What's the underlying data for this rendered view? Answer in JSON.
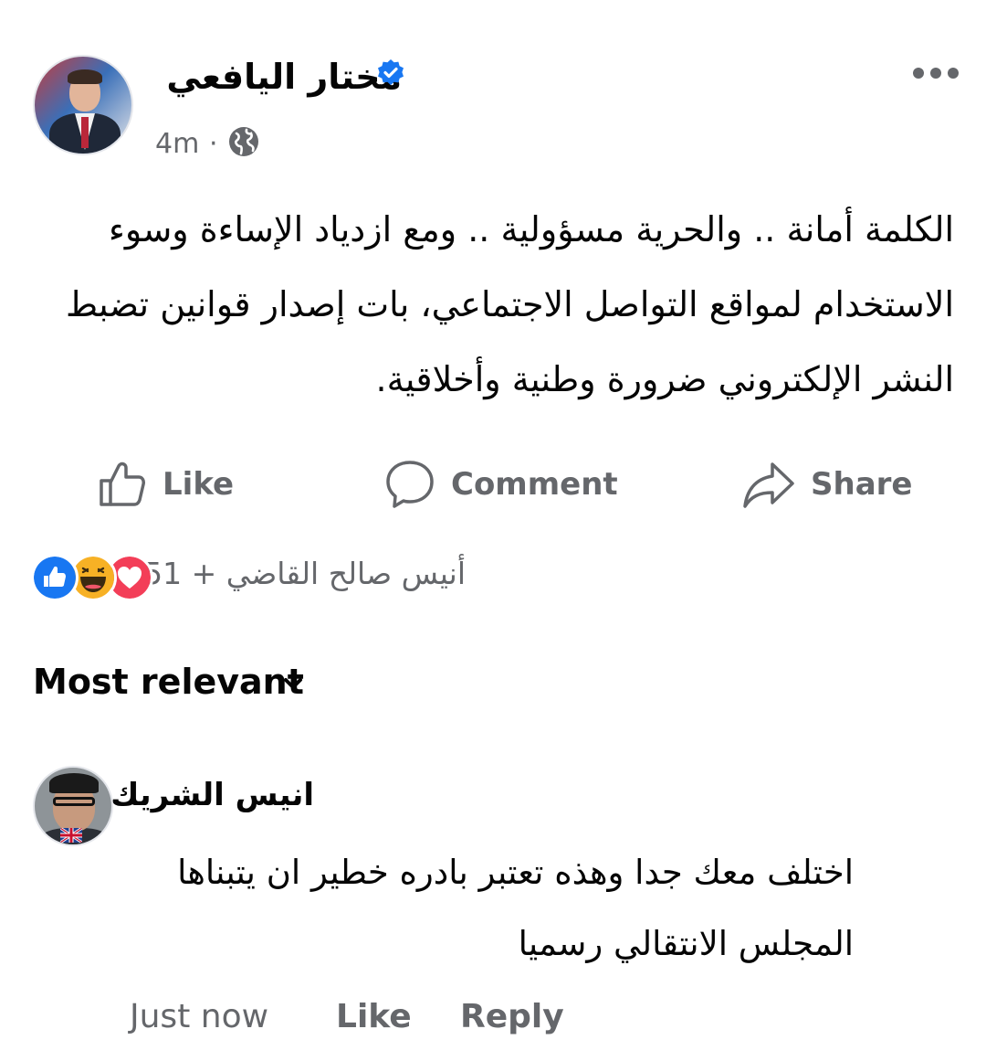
{
  "post": {
    "author": "مختار اليافعي",
    "verified": true,
    "time": "4m",
    "separator": "·",
    "audience_icon": "globe-icon",
    "body": "الكلمة أمانة .. والحرية مسؤولية .. ومع ازدياد الإساءة وسوء الاستخدام لمواقع التواصل الاجتماعي، بات إصدار قوانين تضبط النشر الإلكتروني ضرورة وطنية وأخلاقية."
  },
  "actions": {
    "like_label": "Like",
    "comment_label": "Comment",
    "share_label": "Share"
  },
  "reactions": {
    "icons": [
      "like-icon",
      "haha-icon",
      "love-icon"
    ],
    "summary": "أنيس صالح القاضي + 51"
  },
  "comments_sort": {
    "label": "Most relevant"
  },
  "comment": {
    "author": "انيس الشريك",
    "body": "اختلف معك جدا وهذه تعتبر بادره خطير ان يتبناها المجلس الانتقالي رسميا",
    "time": "Just now",
    "like_label": "Like",
    "reply_label": "Reply"
  },
  "colors": {
    "brand_blue": "#1877f2",
    "secondary_text": "#65676b",
    "primary_text": "#050505",
    "love_red": "#f33e58",
    "haha_yellow": "#f7b125"
  }
}
